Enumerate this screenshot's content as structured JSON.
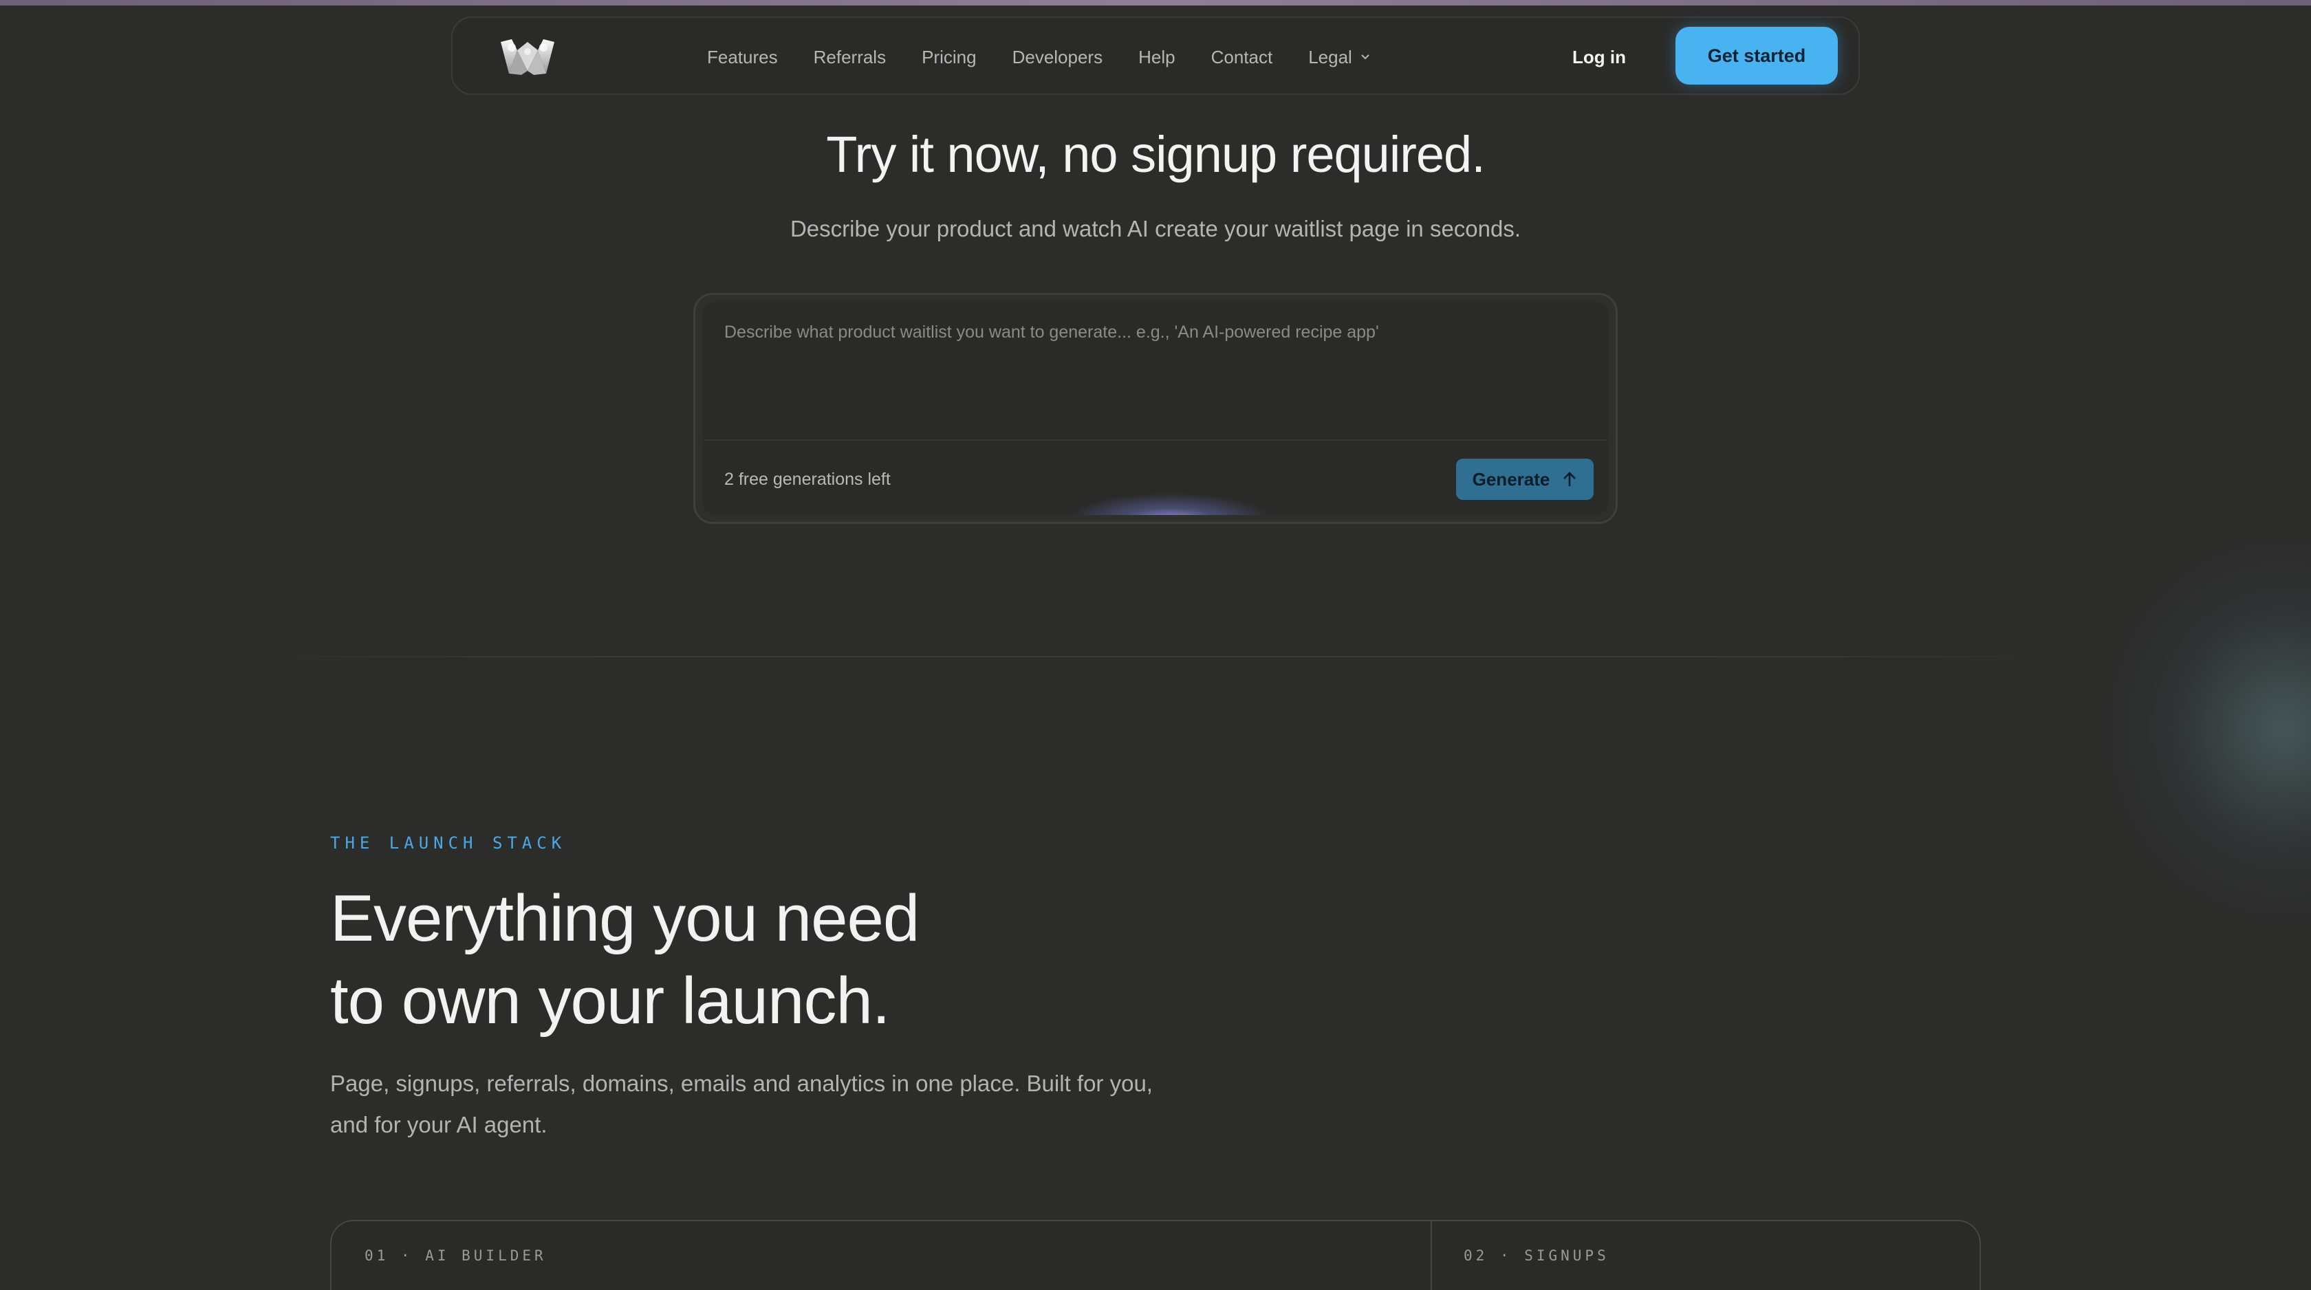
{
  "nav": {
    "logo_name": "w-logo",
    "links": [
      "Features",
      "Referrals",
      "Pricing",
      "Developers",
      "Help",
      "Contact",
      "Legal"
    ],
    "login_label": "Log in",
    "cta_label": "Get started"
  },
  "hero": {
    "title": "Try it now, no signup required.",
    "subtitle": "Describe your product and watch AI create your waitlist page in seconds.",
    "prompt_placeholder": "Describe what product waitlist you want to generate... e.g., 'An AI-powered recipe app'",
    "generations_left": "2 free generations left",
    "generate_label": "Generate"
  },
  "stack": {
    "eyebrow": "THE LAUNCH STACK",
    "title_line1": "Everything you need",
    "title_line2": "to own your launch.",
    "description": "Page, signups, referrals, domains, emails and analytics in one place. Built for you, and for your AI agent.",
    "cards": [
      {
        "label": "01 · AI BUILDER"
      },
      {
        "label": "02 · SIGNUPS"
      }
    ]
  },
  "colors": {
    "background": "#2c2c2b",
    "accent": "#49b3f2",
    "generate_button": "#2f6f92",
    "eyebrow": "#4aa8e6"
  },
  "icons": [
    "w-logo",
    "chevron-down-icon",
    "arrow-up-icon"
  ]
}
